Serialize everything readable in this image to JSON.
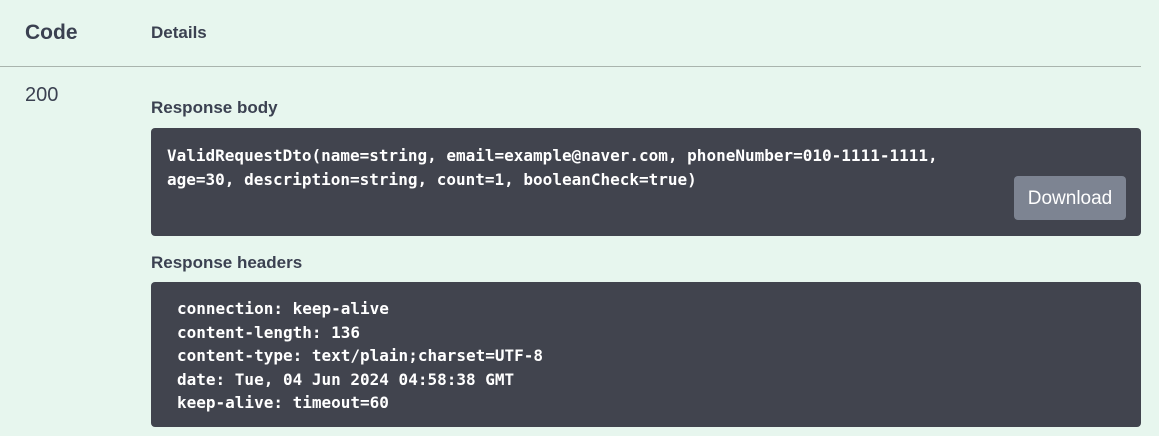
{
  "table": {
    "code_header": "Code",
    "details_header": "Details"
  },
  "response": {
    "status_code": "200",
    "body_label": "Response body",
    "body_text": "ValidRequestDto(name=string, email=example@naver.com, phoneNumber=010-1111-1111,\nage=30, description=string, count=1, booleanCheck=true)",
    "download_label": "Download",
    "headers_label": "Response headers",
    "headers": [
      "connection: keep-alive",
      "content-length: 136",
      "content-type: text/plain;charset=UTF-8",
      "date: Tue, 04 Jun 2024 04:58:38 GMT",
      "keep-alive: timeout=60"
    ]
  },
  "colors": {
    "background": "#e7f6ee",
    "code_block": "#41444e",
    "download_button": "#7d8492",
    "text": "#3b4151"
  }
}
